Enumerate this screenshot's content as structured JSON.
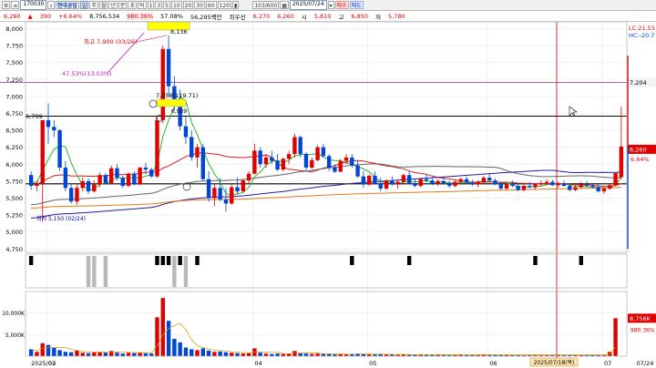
{
  "toolbar": {
    "code": "170030",
    "stock_name": "현대공업",
    "period_buttons": [
      "일",
      "주",
      "월",
      "년",
      "분",
      "초",
      "틱"
    ],
    "minute_buttons": [
      "1",
      "3",
      "5",
      "10",
      "20",
      "30",
      "60",
      "120"
    ],
    "count": "103/600",
    "date": "2025/07/24",
    "buy_label": "매수",
    "sell_label": "매도"
  },
  "quote": {
    "price": "6,260",
    "change": "390",
    "change_pct": "+6.64%",
    "volume": "8,756,534",
    "volume_ratio": "980.36%",
    "rate2": "57.08%",
    "amount": "56,295백만",
    "pref_label": "최우선",
    "pref_value": "6,270",
    "pref_value2": "6,260",
    "open_label": "시",
    "open_value": "5,810",
    "high_label": "고",
    "high_value": "6,850",
    "low_label": "저",
    "low_value": "5,780"
  },
  "colors": {
    "up": "#e00000",
    "down": "#0046d5",
    "ma5": "#2fb52f",
    "ma20": "#d42020",
    "ma60": "#666666",
    "ma120": "#1f1fa0",
    "ma240": "#e07a1a",
    "annot": "#c020c0",
    "vline": "#c00000"
  },
  "chart_data": {
    "type": "candlestick",
    "y_ticks": [
      "8,000",
      "7,750",
      "7,500",
      "7,250",
      "7,000",
      "6,750",
      "6,500",
      "6,250",
      "6,000",
      "5,750",
      "5,500",
      "5,250",
      "5,000",
      "4,750"
    ],
    "ylim": [
      4700,
      8100
    ],
    "x_labels": [
      "2025/02",
      "03",
      "04",
      "05",
      "06",
      "07",
      "07/24"
    ],
    "vol_ticks": [
      "10,000K",
      "5,000K"
    ],
    "right_tags": {
      "lc": "LC:21.55",
      "hc": "HC:-20.7",
      "ref_line": "7,204",
      "price_tag": "6,260",
      "pct_tag": "6.64%",
      "vol_tag": "8,756K",
      "vol_pct": "980.36%"
    },
    "annotations": {
      "high": "최고 7,900 (03/26)",
      "high_pct": "47.53%(13.03%)",
      "low": "최저 5,150 (02/24)",
      "top_box": "8,136",
      "mark_a": "7,058(119.71)",
      "mark_b": "6,939",
      "hline": "6,709",
      "cursor_date": "2025/07/18(목)"
    },
    "lines": {
      "ref": 7204,
      "h1": 6709,
      "h2": 5710
    },
    "candles": [
      [
        5840,
        5900,
        5620,
        5680
      ],
      [
        5680,
        5760,
        5600,
        5720
      ],
      [
        5720,
        6650,
        5150,
        6650
      ],
      [
        6650,
        6900,
        6300,
        6550
      ],
      [
        6550,
        6650,
        6400,
        6500
      ],
      [
        6500,
        6520,
        5900,
        5950
      ],
      [
        5950,
        6050,
        5600,
        5650
      ],
      [
        5650,
        5720,
        5420,
        5450
      ],
      [
        5450,
        5700,
        5400,
        5650
      ],
      [
        5650,
        5800,
        5600,
        5750
      ],
      [
        5750,
        5790,
        5560,
        5600
      ],
      [
        5600,
        5760,
        5580,
        5700
      ],
      [
        5700,
        5880,
        5660,
        5840
      ],
      [
        5840,
        5870,
        5700,
        5720
      ],
      [
        5720,
        5980,
        5700,
        5940
      ],
      [
        5940,
        6000,
        5760,
        5800
      ],
      [
        5800,
        5830,
        5650,
        5680
      ],
      [
        5680,
        5880,
        5660,
        5860
      ],
      [
        5860,
        5900,
        5690,
        5700
      ],
      [
        5700,
        5960,
        5690,
        5950
      ],
      [
        5950,
        6020,
        5850,
        5920
      ],
      [
        5920,
        5950,
        5800,
        5820
      ],
      [
        5820,
        6700,
        5800,
        6650
      ],
      [
        6650,
        7750,
        6600,
        7700
      ],
      [
        7700,
        7900,
        7000,
        7150
      ],
      [
        7150,
        7300,
        6800,
        6880
      ],
      [
        6880,
        7100,
        6500,
        6560
      ],
      [
        6560,
        6700,
        6300,
        6400
      ],
      [
        6400,
        6500,
        6050,
        6100
      ],
      [
        6100,
        6300,
        5950,
        6250
      ],
      [
        6250,
        6300,
        5750,
        5780
      ],
      [
        5780,
        5900,
        5450,
        5500
      ],
      [
        5500,
        5700,
        5380,
        5650
      ],
      [
        5650,
        5800,
        5450,
        5480
      ],
      [
        5480,
        5650,
        5300,
        5420
      ],
      [
        5420,
        5700,
        5400,
        5660
      ],
      [
        5660,
        5800,
        5560,
        5600
      ],
      [
        5600,
        5780,
        5580,
        5760
      ],
      [
        5760,
        5900,
        5720,
        5860
      ],
      [
        5860,
        6300,
        5850,
        6200
      ],
      [
        6200,
        6250,
        5950,
        6000
      ],
      [
        6000,
        6150,
        5950,
        6100
      ],
      [
        6100,
        6200,
        6000,
        6050
      ],
      [
        6050,
        6150,
        5900,
        5920
      ],
      [
        5920,
        6100,
        5900,
        6080
      ],
      [
        6080,
        6200,
        6000,
        6150
      ],
      [
        6150,
        6450,
        6100,
        6400
      ],
      [
        6400,
        6420,
        6100,
        6150
      ],
      [
        6150,
        6180,
        5900,
        5950
      ],
      [
        5950,
        6100,
        5930,
        6060
      ],
      [
        6060,
        6280,
        6040,
        6250
      ],
      [
        6250,
        6300,
        6100,
        6120
      ],
      [
        6120,
        6150,
        5900,
        5950
      ],
      [
        5950,
        6000,
        5870,
        5890
      ],
      [
        5890,
        6080,
        5880,
        6050
      ],
      [
        6050,
        6150,
        6000,
        6100
      ],
      [
        6100,
        6150,
        5950,
        5980
      ],
      [
        5980,
        6050,
        5800,
        5820
      ],
      [
        5820,
        5900,
        5650,
        5700
      ],
      [
        5700,
        5850,
        5680,
        5830
      ],
      [
        5830,
        5900,
        5700,
        5720
      ],
      [
        5720,
        5800,
        5600,
        5640
      ],
      [
        5640,
        5780,
        5620,
        5760
      ],
      [
        5760,
        5820,
        5680,
        5700
      ],
      [
        5700,
        5780,
        5640,
        5740
      ],
      [
        5740,
        5860,
        5720,
        5840
      ],
      [
        5840,
        5900,
        5700,
        5720
      ],
      [
        5720,
        5780,
        5660,
        5680
      ],
      [
        5680,
        5800,
        5660,
        5780
      ],
      [
        5780,
        5850,
        5730,
        5760
      ],
      [
        5760,
        5800,
        5690,
        5710
      ],
      [
        5710,
        5780,
        5680,
        5750
      ],
      [
        5750,
        5820,
        5700,
        5720
      ],
      [
        5720,
        5760,
        5650,
        5680
      ],
      [
        5680,
        5760,
        5660,
        5740
      ],
      [
        5740,
        5800,
        5700,
        5780
      ],
      [
        5780,
        5820,
        5720,
        5730
      ],
      [
        5730,
        5770,
        5680,
        5700
      ],
      [
        5700,
        5760,
        5660,
        5740
      ],
      [
        5740,
        5830,
        5720,
        5800
      ],
      [
        5800,
        5860,
        5740,
        5760
      ],
      [
        5760,
        5790,
        5690,
        5700
      ],
      [
        5700,
        5740,
        5620,
        5640
      ],
      [
        5640,
        5720,
        5620,
        5700
      ],
      [
        5700,
        5760,
        5660,
        5680
      ],
      [
        5680,
        5720,
        5600,
        5620
      ],
      [
        5620,
        5700,
        5600,
        5680
      ],
      [
        5680,
        5740,
        5640,
        5660
      ],
      [
        5660,
        5720,
        5620,
        5700
      ],
      [
        5700,
        5760,
        5670,
        5720
      ],
      [
        5720,
        5780,
        5690,
        5740
      ],
      [
        5740,
        5770,
        5680,
        5690
      ],
      [
        5690,
        5740,
        5650,
        5720
      ],
      [
        5720,
        5760,
        5670,
        5680
      ],
      [
        5680,
        5720,
        5600,
        5620
      ],
      [
        5620,
        5700,
        5600,
        5660
      ],
      [
        5660,
        5740,
        5640,
        5700
      ],
      [
        5700,
        5750,
        5660,
        5680
      ],
      [
        5680,
        5720,
        5640,
        5660
      ],
      [
        5660,
        5700,
        5580,
        5600
      ],
      [
        5600,
        5660,
        5560,
        5640
      ],
      [
        5640,
        5720,
        5620,
        5690
      ],
      [
        5690,
        5870,
        5680,
        5870
      ],
      [
        5810,
        6850,
        5780,
        6260
      ]
    ],
    "volumes": [
      1.6,
      1.0,
      3.0,
      2.6,
      1.9,
      1.4,
      1.0,
      0.9,
      1.3,
      0.8,
      0.7,
      0.9,
      1.0,
      0.9,
      1.2,
      0.8,
      0.6,
      0.8,
      0.7,
      0.9,
      0.7,
      0.6,
      9.0,
      13.5,
      8.2,
      4.0,
      3.2,
      2.0,
      1.6,
      1.4,
      1.8,
      1.3,
      1.0,
      1.1,
      0.9,
      0.8,
      0.7,
      0.6,
      0.7,
      1.8,
      0.8,
      0.6,
      0.5,
      0.6,
      0.5,
      0.6,
      1.2,
      0.7,
      0.6,
      0.5,
      0.6,
      0.5,
      0.5,
      0.4,
      0.5,
      0.4,
      0.5,
      0.6,
      0.5,
      0.4,
      0.4,
      0.5,
      0.4,
      0.4,
      0.3,
      0.4,
      0.4,
      0.3,
      0.4,
      0.3,
      0.3,
      0.4,
      0.3,
      0.3,
      0.3,
      0.4,
      0.3,
      0.3,
      0.3,
      0.4,
      0.3,
      0.3,
      0.3,
      0.3,
      0.3,
      0.3,
      0.3,
      0.3,
      0.3,
      0.3,
      0.3,
      0.3,
      0.3,
      0.3,
      0.3,
      0.3,
      0.3,
      0.3,
      0.3,
      0.3,
      0.3,
      1.0,
      8.8
    ],
    "signals": [
      {
        "i": 0,
        "t": "b"
      },
      {
        "i": 10,
        "t": "g"
      },
      {
        "i": 11,
        "t": "g"
      },
      {
        "i": 13,
        "t": "g"
      },
      {
        "i": 22,
        "t": "b"
      },
      {
        "i": 23,
        "t": "b"
      },
      {
        "i": 24,
        "t": "b"
      },
      {
        "i": 25,
        "t": "g"
      },
      {
        "i": 26,
        "t": "b"
      },
      {
        "i": 27,
        "t": "g"
      },
      {
        "i": 29,
        "t": "b"
      },
      {
        "i": 56,
        "t": "b"
      },
      {
        "i": 66,
        "t": "b"
      },
      {
        "i": 88,
        "t": "b"
      },
      {
        "i": 96,
        "t": "b"
      }
    ]
  }
}
